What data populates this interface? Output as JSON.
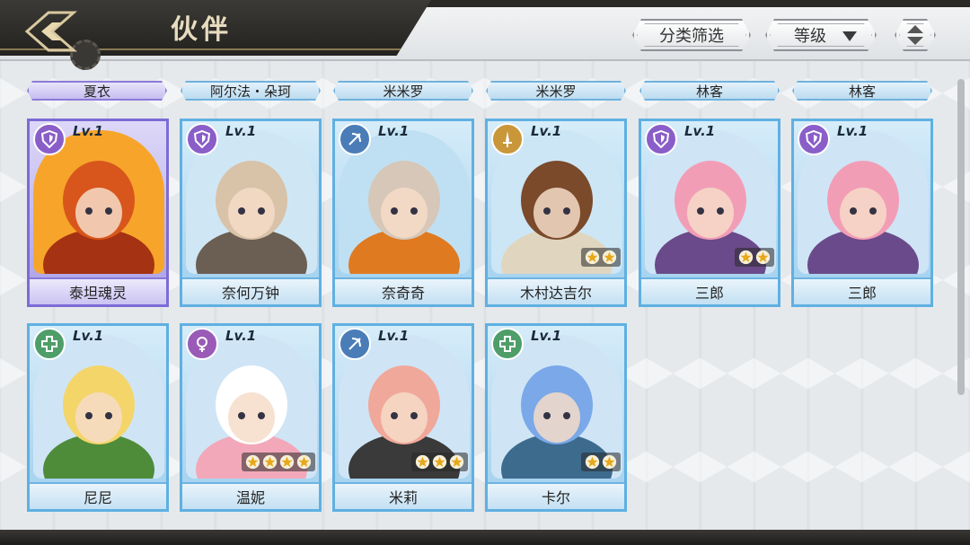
{
  "header": {
    "title": "伙伴",
    "filter_label": "分类筛选",
    "sort_label": "等级"
  },
  "top_labels": [
    "夏衣",
    "阿尔法・朵珂",
    "米米罗",
    "米米罗",
    "林客",
    "林客"
  ],
  "cards": [
    {
      "name": "泰坦魂灵",
      "level": "Lv.1",
      "class_icon": "shield-icon",
      "class_color": "#8a5ec8",
      "stars": 0,
      "frame": "purple"
    },
    {
      "name": "奈何万钟",
      "level": "Lv.1",
      "class_icon": "shield-icon",
      "class_color": "#8a5ec8",
      "stars": 0,
      "frame": "blue"
    },
    {
      "name": "奈奇奇",
      "level": "Lv.1",
      "class_icon": "bow-icon",
      "class_color": "#4a7db8",
      "stars": 0,
      "frame": "blue"
    },
    {
      "name": "木村达吉尔",
      "level": "Lv.1",
      "class_icon": "sword-icon",
      "class_color": "#c9963a",
      "stars": 2,
      "frame": "blue"
    },
    {
      "name": "三郎",
      "level": "Lv.1",
      "class_icon": "shield-icon",
      "class_color": "#8a5ec8",
      "stars": 2,
      "frame": "blue"
    },
    {
      "name": "三郎",
      "level": "Lv.1",
      "class_icon": "shield-icon",
      "class_color": "#8a5ec8",
      "stars": 0,
      "frame": "blue"
    },
    {
      "name": "尼尼",
      "level": "Lv.1",
      "class_icon": "heal-cross-icon",
      "class_color": "#4f9e6a",
      "stars": 0,
      "frame": "blue"
    },
    {
      "name": "温妮",
      "level": "Lv.1",
      "class_icon": "female-icon",
      "class_color": "#9a5bb8",
      "stars": 4,
      "frame": "blue"
    },
    {
      "name": "米莉",
      "level": "Lv.1",
      "class_icon": "bow-icon",
      "class_color": "#4a7db8",
      "stars": 3,
      "frame": "blue"
    },
    {
      "name": "卡尔",
      "level": "Lv.1",
      "class_icon": "heal-cross-icon",
      "class_color": "#4f9e6a",
      "stars": 2,
      "frame": "blue"
    }
  ]
}
